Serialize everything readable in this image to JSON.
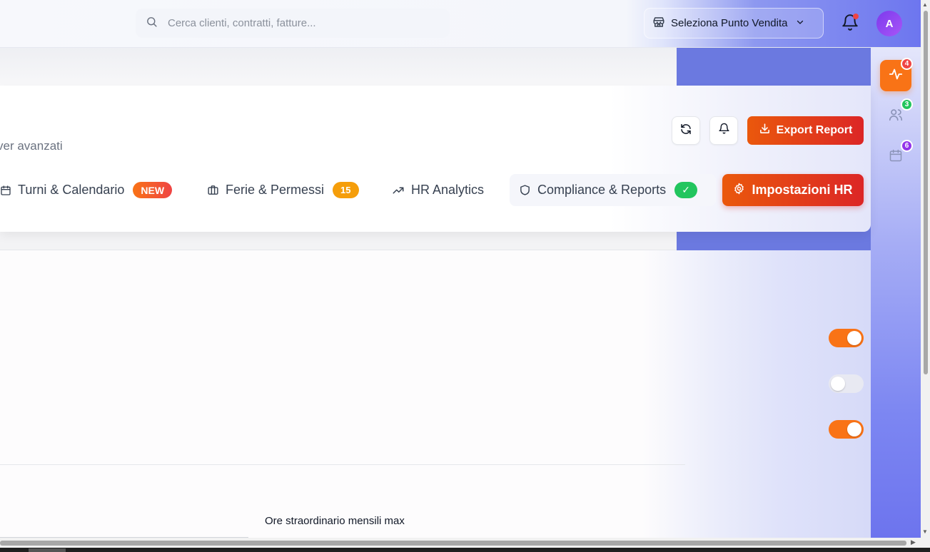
{
  "header": {
    "search_placeholder": "Cerca clienti, contratti, fatture...",
    "store_select_label": "Seleziona Punto Vendita",
    "avatar_initial": "A"
  },
  "card": {
    "subtitle": "ver avanzati",
    "export_label": "Export Report"
  },
  "tabs": [
    {
      "label": "Turni & Calendario",
      "badge": "NEW"
    },
    {
      "label": "Ferie & Permessi",
      "badge": "15"
    },
    {
      "label": "HR Analytics"
    },
    {
      "label": "Compliance & Reports",
      "badge": "✓"
    },
    {
      "label": "Impostazioni HR"
    }
  ],
  "toggles": [
    {
      "state": "on"
    },
    {
      "state": "off"
    },
    {
      "state": "on"
    }
  ],
  "form": {
    "overtime_label": "Ore straordinario mensili max"
  },
  "rail": {
    "activity_badge": "4",
    "users_badge": "3",
    "calendar_badge": "6"
  },
  "colors": {
    "accent_orange": "#f97316",
    "accent_red": "#dc2626",
    "success_green": "#22c55e",
    "warning_amber": "#f59e0b",
    "brand_indigo": "#6b79e0"
  }
}
